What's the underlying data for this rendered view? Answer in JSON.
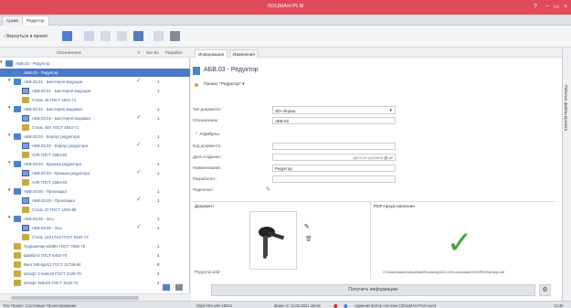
{
  "window": {
    "title": "ЛОЦМАН:PLM",
    "min": "−",
    "max": "▭",
    "close": "×",
    "help": "?"
  },
  "tabs": [
    {
      "label": "Архив"
    },
    {
      "label": "Редуктор"
    }
  ],
  "toolbar": {
    "back_label": "Вернуться в проект"
  },
  "tree": {
    "col_name": "Обозначение",
    "col_x": "✕",
    "col_qty": "Кол-во",
    "col_work": "Разработ",
    "rows": [
      {
        "label": "АБВ.03 - Редуктор",
        "num": "",
        "chk": false
      },
      {
        "label": "АБВ.03 - Редуктор",
        "num": "",
        "chk": false
      },
      {
        "label": "АБВ.03.01 - Шестерня ведущая",
        "num": "1",
        "chk": true
      },
      {
        "label": "АБВ.03.01 - Шестерня ведущая",
        "num": "1",
        "chk": false
      },
      {
        "label": "Сталь 45 ГОСТ 4543-71",
        "num": "",
        "chk": false
      },
      {
        "label": "АБВ.03.02 - Шестерня ведомая",
        "num": "1",
        "chk": false
      },
      {
        "label": "АБВ.03.02 - Шестерня ведомая",
        "num": "1",
        "chk": true
      },
      {
        "label": "Сталь 40Х ГОСТ 4543-71",
        "num": "",
        "chk": false
      },
      {
        "label": "АБВ.03.03 - Корпус редуктора",
        "num": "1",
        "chk": false
      },
      {
        "label": "АБВ.03.03 - Корпус редуктора",
        "num": "1",
        "chk": true
      },
      {
        "label": "АЛ9 ГОСТ 1583-93",
        "num": "",
        "chk": false
      },
      {
        "label": "АБВ.03.04 - Крышка редуктора",
        "num": "1",
        "chk": false
      },
      {
        "label": "АБВ.03.04 - Крышка редуктора",
        "num": "1",
        "chk": true
      },
      {
        "label": "АЛ9 ГОСТ 1583-93",
        "num": "",
        "chk": false
      },
      {
        "label": "АБВ.03.05 - Прокладка",
        "num": "1",
        "chk": false
      },
      {
        "label": "АБВ.03.05 - Прокладка",
        "num": "1",
        "chk": true
      },
      {
        "label": "Сталь 10 ГОСТ 1050-88",
        "num": "",
        "chk": false
      },
      {
        "label": "АБВ.03.06 - Ось",
        "num": "1",
        "chk": false
      },
      {
        "label": "АБВ.03.06 - Ось",
        "num": "1",
        "chk": true
      },
      {
        "label": "Сталь 14Х17Н2 ГОСТ 5632-72",
        "num": "",
        "chk": false
      },
      {
        "label": "Подшипник 6208H ГОСТ 7836-75",
        "num": "1",
        "chk": false
      },
      {
        "label": "Шайба 5 ГОСТ 6402-70",
        "num": "4",
        "chk": false
      },
      {
        "label": "Винт М5-6gx12 ГОСТ 11738-84",
        "num": "8",
        "chk": false
      },
      {
        "label": "Штифт 3 5x8x16 ГОСТ 3128-70",
        "num": "2",
        "chk": false
      },
      {
        "label": "Штифт 5x8x16 ГОСТ 3128-70",
        "num": "2",
        "chk": false
      }
    ]
  },
  "detail": {
    "tabs": [
      {
        "label": "Информация"
      },
      {
        "label": "Изменения"
      }
    ],
    "title": "АБВ.03 - Редуктор",
    "project": "Проект \"Редуктор\" ▾",
    "doc_type_label": "Тип документа :",
    "doc_type_value": "3D-сборка",
    "designation_label": "Обозначение :",
    "designation_value": "АБВ.03",
    "attributes_header": "Атрибуты",
    "code_label": "Код документа :",
    "created_label": "Дата создания :",
    "created_placeholder": "дата не указана",
    "name_label": "Наименование :",
    "name_value": "Редуктор",
    "developer_label": "Разработал :",
    "signer_label": "Подписант :",
    "document_header": "Документ",
    "pdf_header": "PDF-представление",
    "file_name": "Редуктор.a3d",
    "pdf_path": "C:\\Users\\admin\\AppData\\Roaming\\ASCON\\Loodsman\\KOMPAS\\Штиф.pdf",
    "get_info": "Получить информацию"
  },
  "sidetab": {
    "label": "Рабочие файлы проекта"
  },
  "status": {
    "left": "Тип: Проект. Состояние: Проектирование",
    "mid": "https://srv-plm:15912",
    "db": "dbase от 11.05.2021 admin",
    "user": "Администратор системы (ЛОЦМАН:PLM user)",
    "time": "12:48"
  },
  "colors": {
    "accent": "#e04a59",
    "selection": "#4a78c8",
    "ok": "#3aa43a"
  }
}
